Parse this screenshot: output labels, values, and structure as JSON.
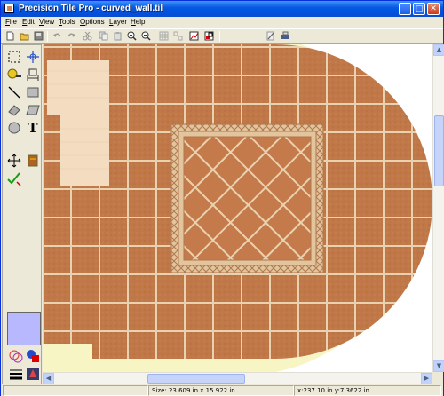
{
  "window": {
    "title": "Precision Tile Pro - curved_wall.til"
  },
  "title_buttons": [
    "_",
    "□",
    "✕"
  ],
  "menu": [
    "File",
    "Edit",
    "View",
    "Tools",
    "Options",
    "Layer",
    "Help"
  ],
  "menu_mnemonics": [
    "F",
    "E",
    "V",
    "T",
    "O",
    "L",
    "H"
  ],
  "palette": {
    "text_tool_glyph": "T"
  },
  "status": {
    "size": "Size: 23.609 in x 15.922 in",
    "coords": "x:237.10 in y:7.3622 in"
  },
  "scroll_arrows": {
    "up": "▲",
    "down": "▼",
    "left": "◀",
    "right": "▶"
  },
  "colors": {
    "tile_base": "#c07848",
    "grout": "#e8d2b0",
    "wall": "#f7f5c4",
    "wood": "#f3dcc0",
    "swatch": "#b8b8ff"
  }
}
